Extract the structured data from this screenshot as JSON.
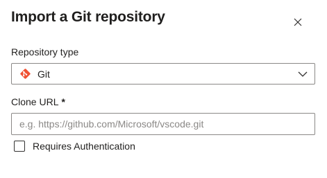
{
  "dialog": {
    "title": "Import a Git repository",
    "close_icon": "close-icon"
  },
  "repository_type": {
    "label": "Repository type",
    "selected_value": "Git",
    "icon": "git-icon",
    "icon_color": "#f05133",
    "dropdown_icon": "chevron-down-icon"
  },
  "clone_url": {
    "label": "Clone URL",
    "required_marker": "*",
    "value": "",
    "placeholder": "e.g. https://github.com/Microsoft/vscode.git"
  },
  "requires_auth": {
    "label": "Requires Authentication",
    "checked": false
  }
}
